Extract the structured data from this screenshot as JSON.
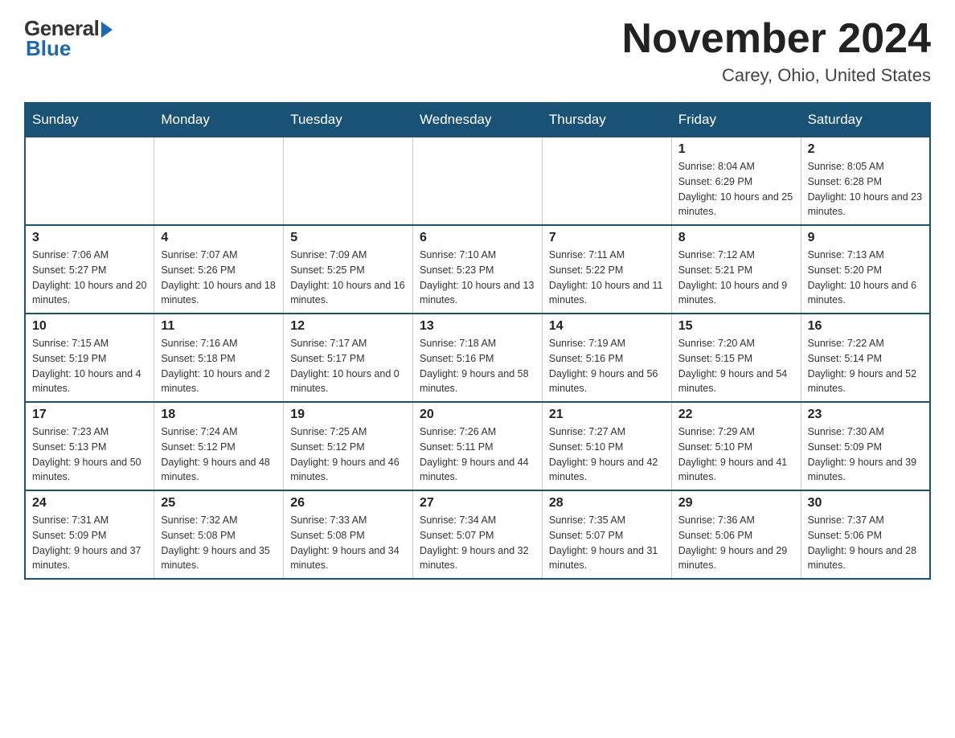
{
  "header": {
    "logo_general": "General",
    "logo_blue": "Blue",
    "month_title": "November 2024",
    "location": "Carey, Ohio, United States"
  },
  "weekdays": [
    "Sunday",
    "Monday",
    "Tuesday",
    "Wednesday",
    "Thursday",
    "Friday",
    "Saturday"
  ],
  "weeks": [
    [
      {
        "day": "",
        "info": ""
      },
      {
        "day": "",
        "info": ""
      },
      {
        "day": "",
        "info": ""
      },
      {
        "day": "",
        "info": ""
      },
      {
        "day": "",
        "info": ""
      },
      {
        "day": "1",
        "info": "Sunrise: 8:04 AM\nSunset: 6:29 PM\nDaylight: 10 hours and 25 minutes."
      },
      {
        "day": "2",
        "info": "Sunrise: 8:05 AM\nSunset: 6:28 PM\nDaylight: 10 hours and 23 minutes."
      }
    ],
    [
      {
        "day": "3",
        "info": "Sunrise: 7:06 AM\nSunset: 5:27 PM\nDaylight: 10 hours and 20 minutes."
      },
      {
        "day": "4",
        "info": "Sunrise: 7:07 AM\nSunset: 5:26 PM\nDaylight: 10 hours and 18 minutes."
      },
      {
        "day": "5",
        "info": "Sunrise: 7:09 AM\nSunset: 5:25 PM\nDaylight: 10 hours and 16 minutes."
      },
      {
        "day": "6",
        "info": "Sunrise: 7:10 AM\nSunset: 5:23 PM\nDaylight: 10 hours and 13 minutes."
      },
      {
        "day": "7",
        "info": "Sunrise: 7:11 AM\nSunset: 5:22 PM\nDaylight: 10 hours and 11 minutes."
      },
      {
        "day": "8",
        "info": "Sunrise: 7:12 AM\nSunset: 5:21 PM\nDaylight: 10 hours and 9 minutes."
      },
      {
        "day": "9",
        "info": "Sunrise: 7:13 AM\nSunset: 5:20 PM\nDaylight: 10 hours and 6 minutes."
      }
    ],
    [
      {
        "day": "10",
        "info": "Sunrise: 7:15 AM\nSunset: 5:19 PM\nDaylight: 10 hours and 4 minutes."
      },
      {
        "day": "11",
        "info": "Sunrise: 7:16 AM\nSunset: 5:18 PM\nDaylight: 10 hours and 2 minutes."
      },
      {
        "day": "12",
        "info": "Sunrise: 7:17 AM\nSunset: 5:17 PM\nDaylight: 10 hours and 0 minutes."
      },
      {
        "day": "13",
        "info": "Sunrise: 7:18 AM\nSunset: 5:16 PM\nDaylight: 9 hours and 58 minutes."
      },
      {
        "day": "14",
        "info": "Sunrise: 7:19 AM\nSunset: 5:16 PM\nDaylight: 9 hours and 56 minutes."
      },
      {
        "day": "15",
        "info": "Sunrise: 7:20 AM\nSunset: 5:15 PM\nDaylight: 9 hours and 54 minutes."
      },
      {
        "day": "16",
        "info": "Sunrise: 7:22 AM\nSunset: 5:14 PM\nDaylight: 9 hours and 52 minutes."
      }
    ],
    [
      {
        "day": "17",
        "info": "Sunrise: 7:23 AM\nSunset: 5:13 PM\nDaylight: 9 hours and 50 minutes."
      },
      {
        "day": "18",
        "info": "Sunrise: 7:24 AM\nSunset: 5:12 PM\nDaylight: 9 hours and 48 minutes."
      },
      {
        "day": "19",
        "info": "Sunrise: 7:25 AM\nSunset: 5:12 PM\nDaylight: 9 hours and 46 minutes."
      },
      {
        "day": "20",
        "info": "Sunrise: 7:26 AM\nSunset: 5:11 PM\nDaylight: 9 hours and 44 minutes."
      },
      {
        "day": "21",
        "info": "Sunrise: 7:27 AM\nSunset: 5:10 PM\nDaylight: 9 hours and 42 minutes."
      },
      {
        "day": "22",
        "info": "Sunrise: 7:29 AM\nSunset: 5:10 PM\nDaylight: 9 hours and 41 minutes."
      },
      {
        "day": "23",
        "info": "Sunrise: 7:30 AM\nSunset: 5:09 PM\nDaylight: 9 hours and 39 minutes."
      }
    ],
    [
      {
        "day": "24",
        "info": "Sunrise: 7:31 AM\nSunset: 5:09 PM\nDaylight: 9 hours and 37 minutes."
      },
      {
        "day": "25",
        "info": "Sunrise: 7:32 AM\nSunset: 5:08 PM\nDaylight: 9 hours and 35 minutes."
      },
      {
        "day": "26",
        "info": "Sunrise: 7:33 AM\nSunset: 5:08 PM\nDaylight: 9 hours and 34 minutes."
      },
      {
        "day": "27",
        "info": "Sunrise: 7:34 AM\nSunset: 5:07 PM\nDaylight: 9 hours and 32 minutes."
      },
      {
        "day": "28",
        "info": "Sunrise: 7:35 AM\nSunset: 5:07 PM\nDaylight: 9 hours and 31 minutes."
      },
      {
        "day": "29",
        "info": "Sunrise: 7:36 AM\nSunset: 5:06 PM\nDaylight: 9 hours and 29 minutes."
      },
      {
        "day": "30",
        "info": "Sunrise: 7:37 AM\nSunset: 5:06 PM\nDaylight: 9 hours and 28 minutes."
      }
    ]
  ]
}
